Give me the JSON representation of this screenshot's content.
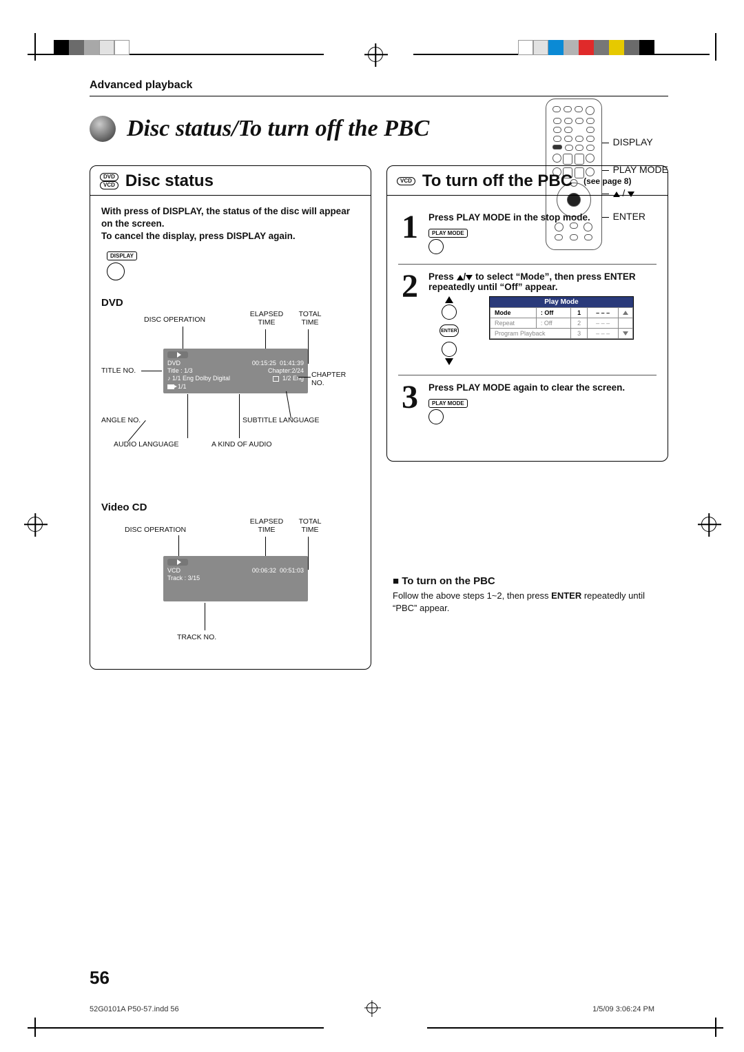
{
  "breadcrumb": "Advanced playback",
  "page_title": "Disc status/To turn off the PBC",
  "remote_labels": {
    "display": "DISPLAY",
    "play_mode": "PLAY MODE",
    "arrows": "▲ / ▼",
    "enter": "ENTER"
  },
  "left": {
    "badges": {
      "dvd": "DVD",
      "vcd": "VCD"
    },
    "title": "Disc status",
    "intro": "With press of DISPLAY, the status of the disc will appear on the screen.\nTo cancel the display, press DISPLAY again.",
    "display_key": "DISPLAY",
    "dvd": {
      "heading": "DVD",
      "labels": {
        "disc_operation": "DISC OPERATION",
        "elapsed": "ELAPSED TIME",
        "total": "TOTAL TIME",
        "title_no": "TITLE NO.",
        "chapter_no": "CHAPTER NO.",
        "angle_no": "ANGLE NO.",
        "subtitle_lang": "SUBTITLE LANGUAGE",
        "audio_lang": "AUDIO LANGUAGE",
        "kind_audio": "A KIND OF AUDIO"
      },
      "osd": {
        "type": "DVD",
        "elapsed": "00:15:25",
        "total": "01:41:39",
        "title": "Title : 1/3",
        "chapter": "Chapter:2/24",
        "audio": "1/1 Eng Dolby Digital",
        "subtitle": "1/2 Eng",
        "angle": "1/1"
      }
    },
    "vcd": {
      "heading": "Video CD",
      "labels": {
        "disc_operation": "DISC OPERATION",
        "elapsed": "ELAPSED TIME",
        "total": "TOTAL TIME",
        "track_no": "TRACK NO."
      },
      "osd": {
        "type": "VCD",
        "elapsed": "00:06:32",
        "total": "00:51:03",
        "track": "Track : 3/15"
      }
    }
  },
  "right": {
    "badge": "VCD",
    "title": "To turn off the PBC",
    "see_page": "(see page 8)",
    "steps": [
      {
        "num": "1",
        "text": "Press PLAY MODE in the stop mode.",
        "key": "PLAY MODE"
      },
      {
        "num": "2",
        "text_pre": "Press ",
        "text_mid": " to select “Mode”, then press ENTER repeatedly until “Off” appear.",
        "enter_label": "ENTER",
        "menu": {
          "title": "Play Mode",
          "rows": [
            {
              "k": "Mode",
              "v": ": Off",
              "n": "1",
              "d": "– – –"
            },
            {
              "k": "Repeat",
              "v": ": Off",
              "n": "2",
              "d": "– – –"
            },
            {
              "k": "Program Playback",
              "v": "",
              "n": "3",
              "d": "– – –"
            }
          ]
        }
      },
      {
        "num": "3",
        "text": "Press PLAY MODE again to clear the screen.",
        "key": "PLAY MODE"
      }
    ],
    "note_head": "To turn on the PBC",
    "note_body_pre": "Follow the above steps 1~2, then press ",
    "note_body_bold": "ENTER",
    "note_body_post": " repeatedly until “PBC” appear."
  },
  "page_number": "56",
  "footer": {
    "file": "52G0101A P50-57.indd   56",
    "date": "1/5/09   3:06:24 PM"
  },
  "crop_colors": {
    "set1": [
      "#000",
      "#6b6b6b",
      "#a8a8a8",
      "#e2e2e2",
      "#ffffff"
    ],
    "set2": [
      "#ffffff",
      "#e2e2e2",
      "#0b8ad5",
      "#b3b3b3",
      "#e02a2a",
      "#777",
      "#e6c900",
      "#6b6b6b",
      "#000"
    ]
  }
}
